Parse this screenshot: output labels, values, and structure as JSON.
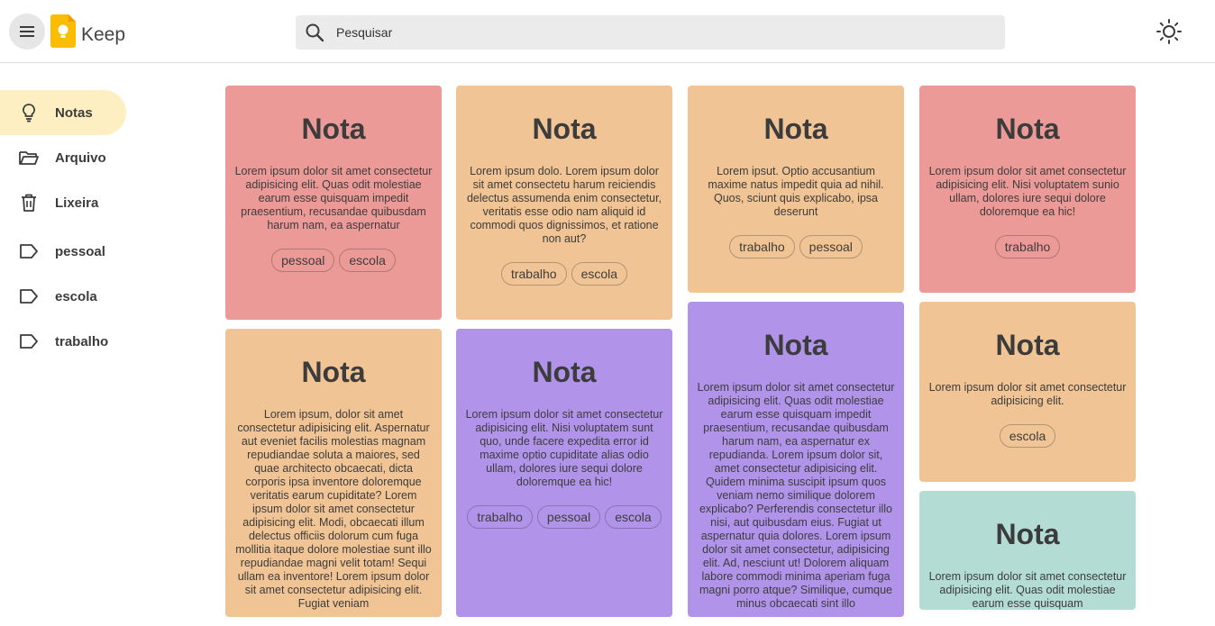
{
  "header": {
    "app_title": "Keep",
    "search_placeholder": "Pesquisar"
  },
  "sidebar": {
    "items": [
      {
        "label": "Notas",
        "icon": "lightbulb-icon",
        "active": true
      },
      {
        "label": "Arquivo",
        "icon": "folder-open-icon"
      },
      {
        "label": "Lixeira",
        "icon": "trash-icon"
      },
      {
        "label": "pessoal",
        "icon": "label-icon"
      },
      {
        "label": "escola",
        "icon": "label-icon"
      },
      {
        "label": "trabalho",
        "icon": "label-icon"
      }
    ]
  },
  "colors": {
    "red": "#ec9a97",
    "orange": "#f1c495",
    "purple": "#b194ea",
    "teal": "#b3dcd4",
    "active_nav": "#feefc3"
  },
  "columns": [
    [
      {
        "title": "Nota",
        "color": "#ec9a97",
        "body": "Lorem ipsum dolor sit amet consectetur adipisicing elit. Quas odit molestiae earum esse quisquam impedit praesentium, recusandae quibusdam harum nam, ea aspernatur",
        "tags": [
          "pessoal",
          "escola"
        ]
      },
      {
        "title": "Nota",
        "color": "#f1c495",
        "body": "Lorem ipsum, dolor sit amet consectetur adipisicing elit. Aspernatur aut eveniet facilis molestias magnam repudiandae soluta a maiores, sed quae architecto obcaecati, dicta corporis ipsa inventore doloremque veritatis earum cupiditate? Lorem ipsum dolor sit amet consectetur adipisicing elit. Modi, obcaecati illum delectus officiis dolorum cum fuga mollitia itaque dolore molestiae sunt illo repudiandae magni velit totam! Sequi ullam ea inventore! Lorem ipsum dolor sit amet consectetur adipisicing elit. Fugiat veniam",
        "tags": []
      }
    ],
    [
      {
        "title": "Nota",
        "color": "#f1c495",
        "body": "Lorem ipsum dolo. Lorem ipsum dolor sit amet consectetu harum reiciendis delectus assumenda enim consectetur, veritatis esse odio nam aliquid id commodi quos dignissimos, et ratione non aut?",
        "tags": [
          "trabalho",
          "escola"
        ]
      },
      {
        "title": "Nota",
        "color": "#b194ea",
        "body": "Lorem ipsum dolor sit amet consectetur adipisicing elit. Nisi voluptatem sunt quo, unde facere expedita error id maxime optio cupiditate alias odio ullam, dolores iure sequi dolore doloremque ea hic!",
        "tags": [
          "trabalho",
          "pessoal",
          "escola"
        ]
      }
    ],
    [
      {
        "title": "Nota",
        "color": "#f1c495",
        "body": "Lorem ipsut. Optio accusantium maxime natus impedit quia ad nihil. Quos, sciunt quis explicabo, ipsa deserunt",
        "tags": [
          "trabalho",
          "pessoal"
        ]
      },
      {
        "title": "Nota",
        "color": "#b194ea",
        "body": "Lorem ipsum dolor sit amet consectetur adipisicing elit. Quas odit molestiae earum esse quisquam impedit praesentium, recusandae quibusdam harum nam, ea aspernatur ex repudianda. Lorem ipsum dolor sit, amet consectetur adipisicing elit. Quidem minima suscipit ipsum quos veniam nemo similique dolorem explicabo? Perferendis consectetur illo nisi, aut quibusdam eius. Fugiat ut aspernatur quia dolores. Lorem ipsum dolor sit amet consectetur, adipisicing elit. Ad, nesciunt ut! Dolorem aliquam labore commodi minima aperiam fuga magni porro atque? Similique, cumque minus obcaecati sint illo",
        "tags": []
      }
    ],
    [
      {
        "title": "Nota",
        "color": "#ec9a97",
        "body": "Lorem ipsum dolor sit amet consectetur adipisicing elit. Nisi voluptatem sunio ullam, dolores iure sequi dolore doloremque ea hic!",
        "tags": [
          "trabalho"
        ]
      },
      {
        "title": "Nota",
        "color": "#f1c495",
        "body": "Lorem ipsum dolor sit amet consectetur adipisicing elit.",
        "tags": [
          "escola"
        ]
      },
      {
        "title": "Nota",
        "color": "#b3dcd4",
        "body": "Lorem ipsum dolor sit amet consectetur adipisicing elit. Quas odit molestiae earum esse quisquam",
        "tags": []
      }
    ]
  ]
}
